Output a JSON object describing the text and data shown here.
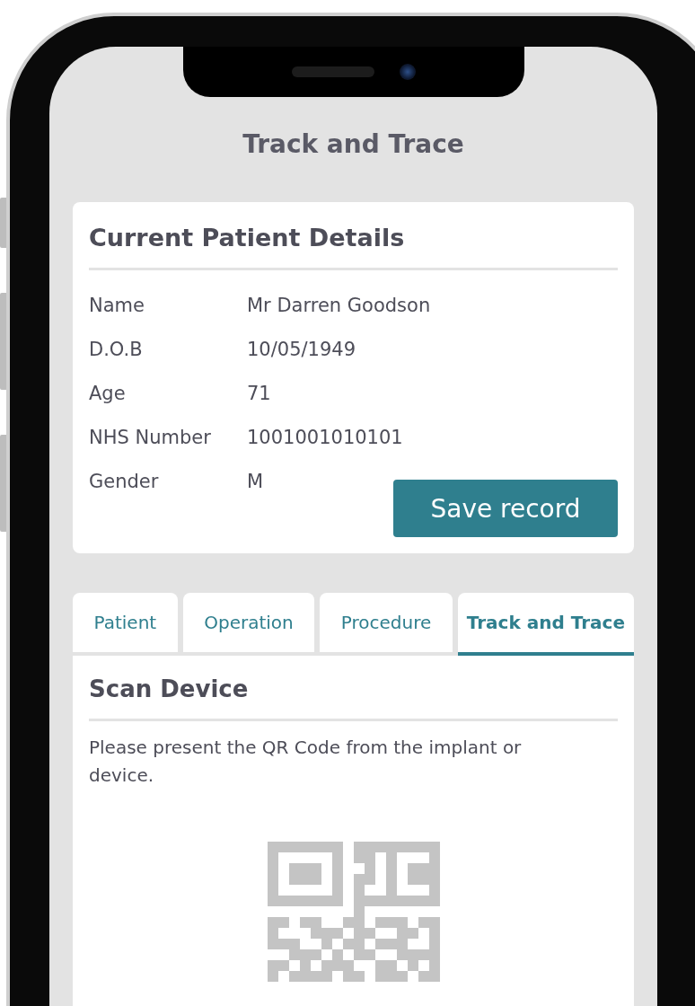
{
  "header": {
    "title": "Track and Trace"
  },
  "patient_card": {
    "title": "Current Patient Details",
    "fields": [
      {
        "label": "Name",
        "value": "Mr Darren Goodson"
      },
      {
        "label": "D.O.B",
        "value": "10/05/1949"
      },
      {
        "label": "Age",
        "value": "71"
      },
      {
        "label": "NHS Number",
        "value": "1001001010101"
      },
      {
        "label": "Gender",
        "value": "M"
      }
    ],
    "button": "Save record"
  },
  "tabs": [
    {
      "label": "Patient",
      "selected": false
    },
    {
      "label": "Operation",
      "selected": false
    },
    {
      "label": "Procedure",
      "selected": false
    },
    {
      "label": "Track and Trace",
      "selected": true
    }
  ],
  "scan_panel": {
    "title": "Scan Device",
    "instructions": "Please present the QR Code from the implant or device."
  }
}
